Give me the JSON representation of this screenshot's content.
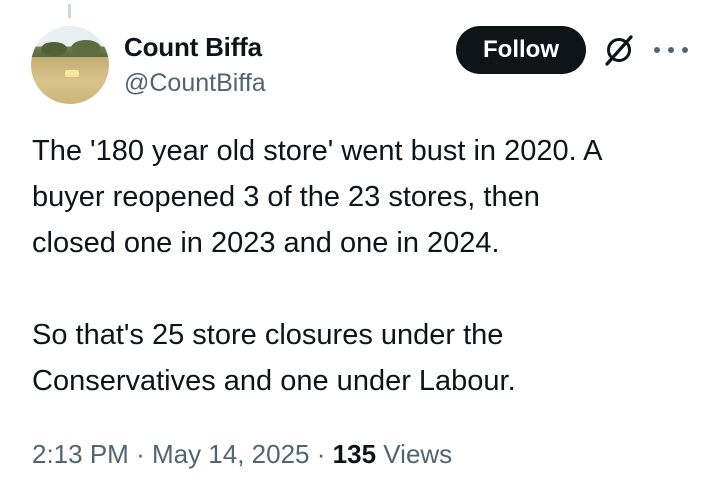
{
  "author": {
    "display_name": "Count Biffa",
    "handle": "@CountBiffa",
    "avatar_icon": "landscape-avatar"
  },
  "actions": {
    "follow_label": "Follow",
    "grok_icon": "grok-icon",
    "more_icon": "more-options-icon"
  },
  "tweet": {
    "paragraphs": [
      [
        "The '180 year old store' went bust in 2020. A",
        "buyer reopened 3 of the 23 stores, then",
        "closed one in 2023 and one in 2024."
      ],
      [
        "So that's 25 store closures under the",
        "Conservatives and one under Labour."
      ]
    ]
  },
  "meta": {
    "time": "2:13 PM",
    "separator": "·",
    "date": "May 14, 2025",
    "views_count": "135",
    "views_label": "Views"
  }
}
